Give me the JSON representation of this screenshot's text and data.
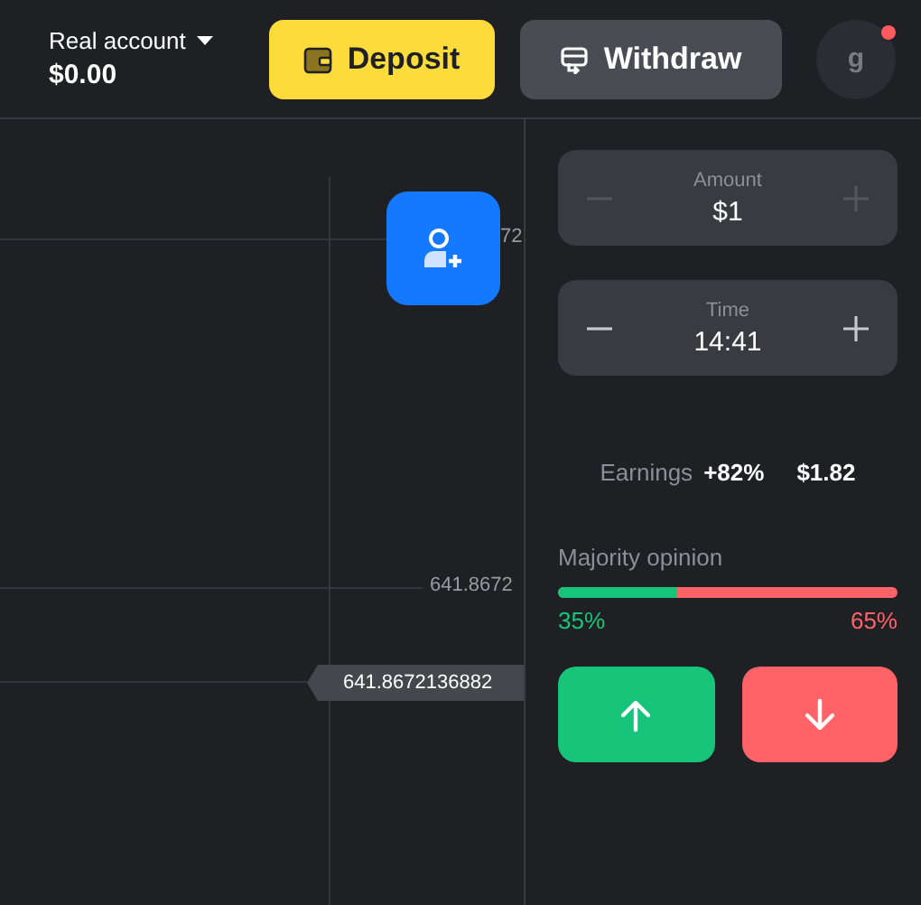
{
  "header": {
    "account_label": "Real account",
    "balance": "$0.00",
    "deposit_button": "Deposit",
    "withdraw_button": "Withdraw",
    "avatar_initial": "g",
    "notification": true
  },
  "chart": {
    "price_labels": [
      {
        "kind": "partial",
        "text": "72"
      },
      {
        "kind": "grid",
        "text": "641.8672"
      },
      {
        "kind": "current",
        "text": "641.8672136882"
      }
    ]
  },
  "panel": {
    "steppers": [
      {
        "label": "Amount",
        "value": "$1",
        "disabled": true
      },
      {
        "label": "Time",
        "value": "14:41",
        "disabled": false
      }
    ],
    "earnings": {
      "label": "Earnings",
      "percent": "+82%",
      "amount": "$1.82"
    },
    "majority": {
      "title": "Majority opinion",
      "level": 0.35,
      "up": "35%",
      "down": "65%"
    },
    "buttons": [
      {
        "kind": "up"
      },
      {
        "kind": "down"
      }
    ]
  }
}
